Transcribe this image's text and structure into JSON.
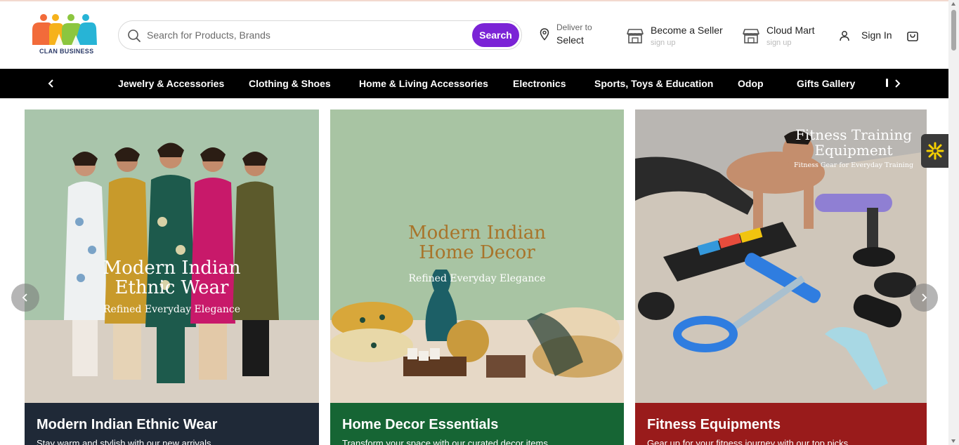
{
  "header": {
    "logo_text": "CLAN BUSINESS",
    "search": {
      "placeholder": "Search for Products, Brands",
      "button_label": "Search"
    },
    "deliver": {
      "label": "Deliver to",
      "value": "Select"
    },
    "become_seller": {
      "title": "Become a Seller",
      "sub": "sign up"
    },
    "cloud_mart": {
      "title": "Cloud Mart",
      "sub": "sign up"
    },
    "sign_in": "Sign In",
    "accent_color": "#7b23d6"
  },
  "nav": {
    "items": [
      "Jewelry & Accessories",
      "Clothing & Shoes",
      "Home & Living Accessories",
      "Electronics",
      "Sports, Toys & Education",
      "Odop",
      "Gifts Gallery"
    ],
    "prev_icon": "chevron-left-icon",
    "next_icon": "chevron-right-icon"
  },
  "cards": [
    {
      "overlay_title_1": "Modern Indian",
      "overlay_title_2": "Ethnic Wear",
      "overlay_sub": "Refined Everyday Elegance",
      "title": "Modern Indian Ethnic Wear",
      "subtitle": "Stay warm and stylish with our new arrivals",
      "bar_color": "#1f2937"
    },
    {
      "overlay_title_1": "Modern Indian",
      "overlay_title_2": "Home Decor",
      "overlay_sub": "Refined Everyday Elegance",
      "title": "Home Decor Essentials",
      "subtitle": "Transform your space with our curated decor items",
      "bar_color": "#166534"
    },
    {
      "overlay_title_1": "Fitness Training",
      "overlay_title_2": "Equipment",
      "overlay_sub": "Fitness Gear for Everyday Training",
      "title": "Fitness Equipments",
      "subtitle": "Gear up for your fitness journey with our top picks",
      "bar_color": "#991b1b"
    }
  ]
}
